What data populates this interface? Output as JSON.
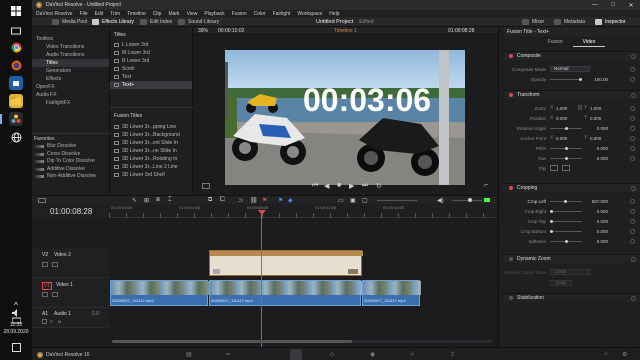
{
  "taskbar": {
    "clock_time": "11:33",
    "clock_date": "28.09.2020"
  },
  "window": {
    "title": "DaVinci Resolve - Untitled Project",
    "controls": [
      "—",
      "□",
      "✕"
    ]
  },
  "menu": [
    "DaVinci Resolve",
    "File",
    "Edit",
    "Trim",
    "Timeline",
    "Clip",
    "Mark",
    "View",
    "Playback",
    "Fusion",
    "Color",
    "Fairlight",
    "Workspace",
    "Help"
  ],
  "toolbar": {
    "media_pool": "Media Pool",
    "effects_library": "Effects Library",
    "edit_index": "Edit Index",
    "sound_library": "Sound Library",
    "project_title": "Untitled Project",
    "project_status": "Edited",
    "mixer": "Mixer",
    "metadata": "Metadata",
    "inspector": "Inspector"
  },
  "effects_panel": {
    "tree": [
      {
        "label": "Toolbox",
        "indent": 0
      },
      {
        "label": "Video Transitions",
        "indent": 1
      },
      {
        "label": "Audio Transitions",
        "indent": 1
      },
      {
        "label": "Titles",
        "indent": 1,
        "selected": true
      },
      {
        "label": "Generators",
        "indent": 1
      },
      {
        "label": "Effects",
        "indent": 1
      },
      {
        "label": "OpenFX",
        "indent": 0
      },
      {
        "label": "Audio FX",
        "indent": 0
      },
      {
        "label": "FairlightFX",
        "indent": 1
      }
    ],
    "favorites_header": "Favorites",
    "favorites": [
      "Blur Dissolve",
      "Cross Dissolve",
      "Dip To Color Dissolve",
      "Additive Dissolve",
      "Non-Additive Dissolve"
    ]
  },
  "titles_panel": {
    "header": "Titles",
    "items": [
      "L Lower 3rd",
      "M Lower 3rd",
      "R Lower 3rd",
      "Scroll",
      "Text",
      "Text+"
    ],
    "fusion_header": "Fusion Titles",
    "fusion_items": [
      "3D Lower 3r...pping Line",
      "3D Lower 3r...Background",
      "3D Lower 3r...ext Slide In",
      "3D Lower 3r...ne Slide In",
      "3D Lower 3r...Rotating In",
      "3D Lower 3r...Line 2 Line",
      "3D Lower 3rd Shelf"
    ]
  },
  "viewer": {
    "zoom": "39%",
    "source_timecode": "00:00:10:02",
    "timeline_name": "Timeline 1",
    "record_timecode": "01:00:08:28",
    "overlay_text": "00:03:06"
  },
  "inspector": {
    "title": "Fusion Title - Text+",
    "tabs": [
      "Fusion",
      "Video"
    ],
    "active_tab": "Video",
    "sections": {
      "composite": "Composite",
      "transform": "Transform",
      "cropping": "Cropping",
      "dynamic_zoom": "Dynamic Zoom",
      "stabilization": "Stabilization"
    },
    "composite": {
      "mode_label": "Composite Mode",
      "mode_value": "Normal",
      "opacity_label": "Opacity",
      "opacity_value": "100.00"
    },
    "transform": {
      "zoom_label": "Zoom",
      "zoom_x": "1.000",
      "zoom_y": "1.000",
      "position_label": "Position",
      "position_x": "0.000",
      "position_y": "0.000",
      "rotation_label": "Rotation Angle",
      "rotation_value": "0.000",
      "anchor_label": "Anchor Point",
      "anchor_x": "0.000",
      "anchor_y": "0.000",
      "pitch_label": "Pitch",
      "pitch_value": "0.000",
      "yaw_label": "Yaw",
      "yaw_value": "0.000",
      "flip_label": "Flip"
    },
    "cropping": {
      "crop_left_label": "Crop Left",
      "crop_left_value": "597.000",
      "crop_right_label": "Crop Right",
      "crop_right_value": "0.000",
      "crop_top_label": "Crop Top",
      "crop_top_value": "0.000",
      "crop_bottom_label": "Crop Bottom",
      "crop_bottom_value": "0.000",
      "softness_label": "Softness",
      "softness_value": "0.000"
    },
    "dynamic_zoom": {
      "ease_label": "Dynamic Zoom Ease",
      "ease_value": "Linear",
      "swap_label": "Swap"
    }
  },
  "timeline": {
    "timecode": "01:00:08:28",
    "ruler_labels": [
      "01:00:00:00",
      "01:00:04:00",
      "01:00:08:00",
      "01:00:12:00",
      "01:00:16:00"
    ],
    "tracks": [
      {
        "id": "V2",
        "name": "Video 2"
      },
      {
        "id": "V1",
        "name": "Video 1"
      },
      {
        "id": "A1",
        "name": "Audio 1",
        "level": "2.0"
      }
    ],
    "clips": {
      "v1_a": "20200927_111417.mp4",
      "v1_b": "20200927_111417.mp4",
      "v1_c": "20200927_111417.mp4"
    }
  },
  "statusbar": {
    "app": "DaVinci Resolve 16"
  }
}
